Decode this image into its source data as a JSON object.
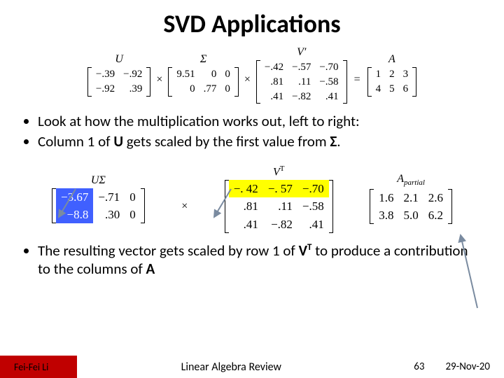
{
  "title": "SVD Applications",
  "svd_top": {
    "U_label": "U",
    "U": [
      [
        "−.39",
        "−.92"
      ],
      [
        "−.92",
        ".39"
      ]
    ],
    "Sigma_label": "Σ",
    "Sigma": [
      [
        "9.51",
        "0",
        "0"
      ],
      [
        "0",
        ".77",
        "0"
      ]
    ],
    "Vt_label": "V′",
    "Vt": [
      [
        "−.42",
        "−.57",
        "−.70"
      ],
      [
        ".81",
        ".11",
        "−.58"
      ],
      [
        ".41",
        "−.82",
        ".41"
      ]
    ],
    "A_label": "A",
    "A": [
      [
        "1",
        "2",
        "3"
      ],
      [
        "4",
        "5",
        "6"
      ]
    ],
    "times": "×",
    "equals": "="
  },
  "bullets_a": [
    "Look at how the multiplication works out, left to right:",
    "Column 1 of U gets scaled by the first value from Σ."
  ],
  "svd_mid": {
    "USigma_label": "UΣ",
    "USigma_col1": [
      "−3.67",
      "−8.8"
    ],
    "USigma_rest": [
      [
        "−.71",
        "0"
      ],
      [
        ".30",
        "0"
      ]
    ],
    "times": "×",
    "Vt_label_base": "V",
    "Vt_label_sup": "T",
    "Vt_row1": [
      "−. 42",
      "−. 57",
      "−.70"
    ],
    "Vt_rest": [
      [
        ".81",
        ".11",
        "−.58"
      ],
      [
        ".41",
        "−.82",
        ".41"
      ]
    ],
    "Ap_label_base": "A",
    "Ap_label_sub": "partial",
    "Ap": [
      [
        "1.6",
        "2.1",
        "2.6"
      ],
      [
        "3.8",
        "5.0",
        "6.2"
      ]
    ]
  },
  "bullets_b": [
    "The resulting vector gets scaled by row 1 of VT to produce a contribution to the columns of A"
  ],
  "footer": {
    "author": "Fei-Fei Li",
    "course": "Linear Algebra Review",
    "pageno": "63",
    "date": "29-Nov-20"
  }
}
